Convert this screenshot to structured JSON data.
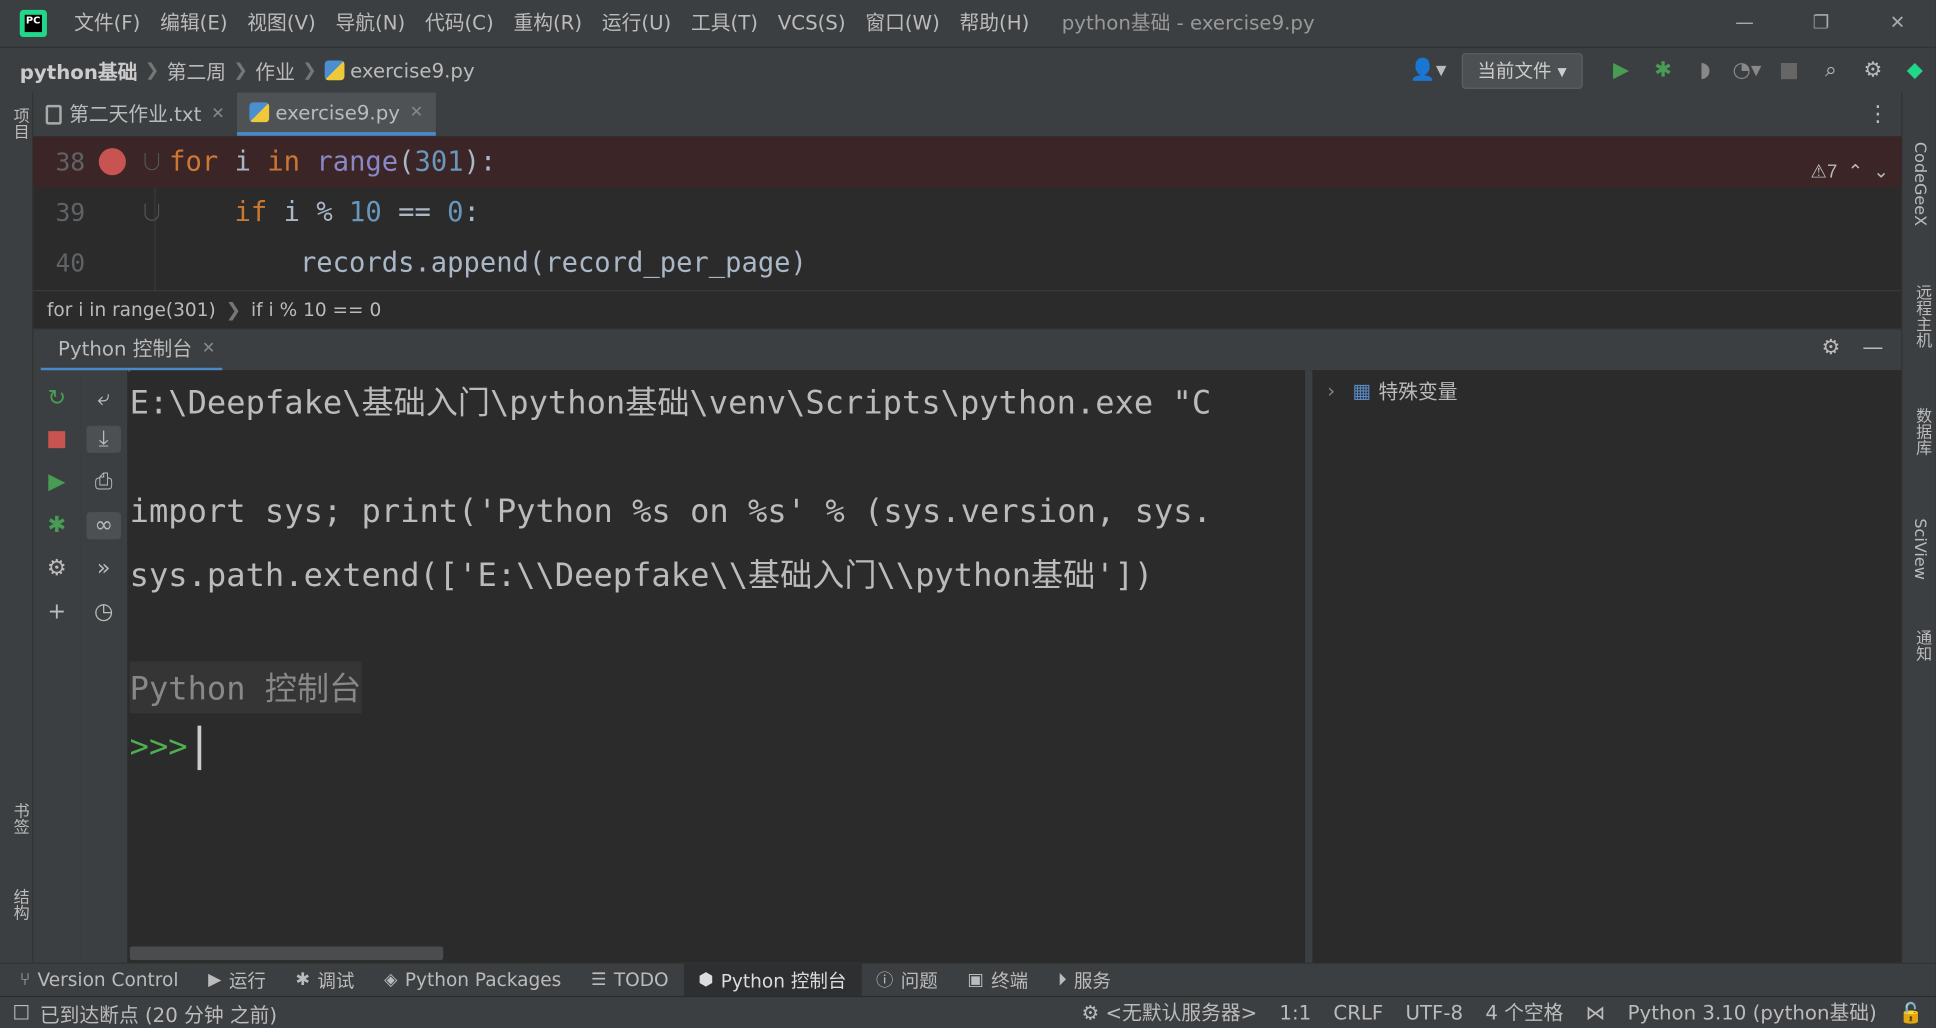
{
  "window": {
    "title": "python基础 - exercise9.py",
    "minimize": "—",
    "restore": "❐",
    "close": "✕"
  },
  "menu": [
    "文件(F)",
    "编辑(E)",
    "视图(V)",
    "导航(N)",
    "代码(C)",
    "重构(R)",
    "运行(U)",
    "工具(T)",
    "VCS(S)",
    "窗口(W)",
    "帮助(H)"
  ],
  "breadcrumb": {
    "project": "python基础",
    "week": "第二周",
    "folder": "作业",
    "file": "exercise9.py"
  },
  "toolbar": {
    "run_config": "当前文件"
  },
  "left_strip": {
    "project": "项目",
    "bookmarks": "书签",
    "structure": "结构"
  },
  "right_strip": {
    "codegeex": "CodeGeeX",
    "remote": "远程主机",
    "database": "数据库",
    "sciview": "SciView",
    "notifications": "通知"
  },
  "editor_tabs": [
    {
      "label": "第二天作业.txt"
    },
    {
      "label": "exercise9.py"
    }
  ],
  "editor": {
    "lines": [
      {
        "num": "38",
        "kw1": "for",
        "sp1": " i ",
        "kw2": "in",
        "sp2": " ",
        "fn": "range",
        "p1": "(",
        "num_lit": "301",
        "p2": "):"
      },
      {
        "num": "39",
        "indent": "    ",
        "kw": "if",
        "rest1": " i % ",
        "n1": "10",
        "rest2": " == ",
        "n2": "0",
        "rest3": ":"
      },
      {
        "num": "40",
        "text": "        records.append(record_per_page)"
      }
    ],
    "warnings": "7"
  },
  "code_breadcrumb": [
    "for i in range(301)",
    "if i % 10 == 0"
  ],
  "tool_window": {
    "tab": "Python 控制台"
  },
  "console": {
    "line1": "E:\\Deepfake\\基础入门\\python基础\\venv\\Scripts\\python.exe \"C",
    "line2": "import sys; print('Python %s on %s' % (sys.version, sys.",
    "line3": "sys.path.extend(['E:\\\\Deepfake\\\\基础入门\\\\python基础'])",
    "line4": "Python 控制台",
    "prompt": ">>>"
  },
  "variables": {
    "special": "特殊变量"
  },
  "bottom_tools": [
    "Version Control",
    "运行",
    "调试",
    "Python Packages",
    "TODO",
    "Python 控制台",
    "问题",
    "终端",
    "服务"
  ],
  "status": {
    "message": "已到达断点 (20 分钟 之前)",
    "server": "<无默认服务器>",
    "position": "1:1",
    "line_ending": "CRLF",
    "encoding": "UTF-8",
    "indent": "4 个空格",
    "interpreter": "Python 3.10 (python基础)"
  }
}
